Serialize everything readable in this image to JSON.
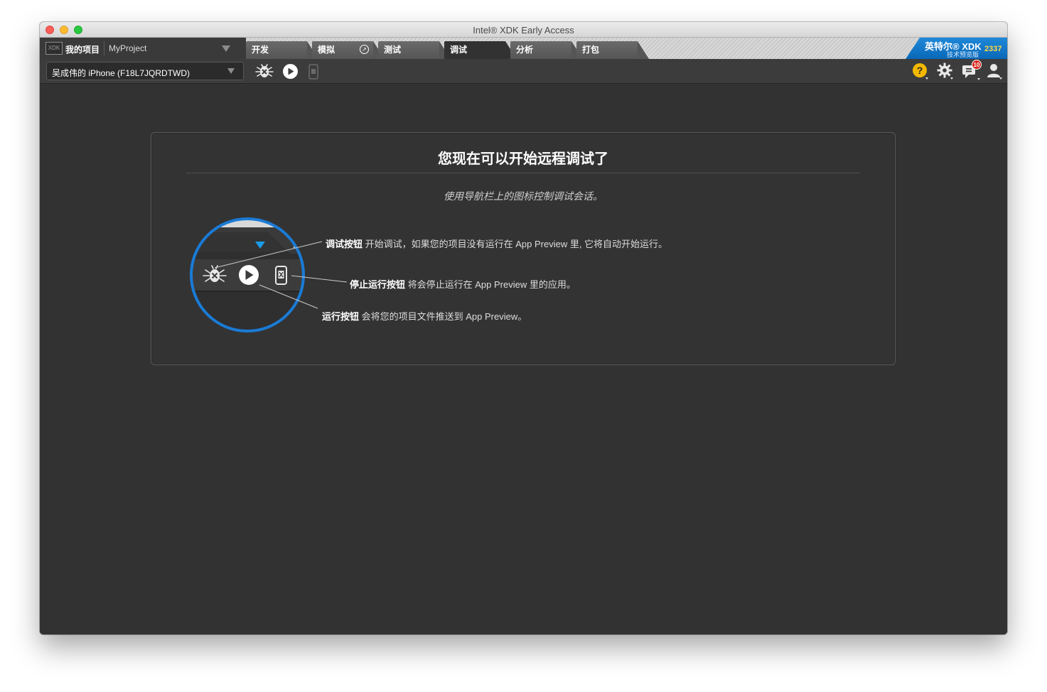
{
  "window": {
    "title": "Intel® XDK Early Access"
  },
  "tabbar": {
    "logo_text": "XDK",
    "project_label": "我的项目",
    "project_name": "MyProject",
    "tabs": [
      {
        "label": "开发",
        "active": false
      },
      {
        "label": "模拟",
        "active": false
      },
      {
        "label": "测试",
        "active": false
      },
      {
        "label": "调试",
        "active": true
      },
      {
        "label": "分析",
        "active": false
      },
      {
        "label": "打包",
        "active": false
      }
    ],
    "brand": {
      "name": "英特尔® XDK",
      "subtitle": "技术预览版",
      "build": "2337"
    }
  },
  "toolbar": {
    "device": "吴成伟的 iPhone (F18L7JQRDTWD)",
    "notification_count": "10",
    "icons": [
      "bug-debug-icon",
      "play-icon",
      "stop-app-icon",
      "help-icon",
      "gear-icon",
      "notifications-icon",
      "user-icon"
    ]
  },
  "panel": {
    "title": "您现在可以开始远程调试了",
    "subtitle": "使用导航栏上的图标控制调试会话。",
    "callouts": {
      "debug": {
        "bold": "调试按钮",
        "text": " 开始调试，如果您的项目没有运行在 App Preview 里, 它将自动开始运行。"
      },
      "stop": {
        "bold": "停止运行按钮",
        "text": " 将会停止运行在 App Preview 里的应用。"
      },
      "run": {
        "bold": "运行按钮",
        "text": " 会将您的项目文件推送到 App Preview。"
      }
    }
  },
  "colors": {
    "accent_blue": "#1a7bd6",
    "background": "#323232",
    "brand_yellow": "#ffd54a",
    "help_yellow": "#f5b800",
    "badge_red": "#d9251c"
  }
}
